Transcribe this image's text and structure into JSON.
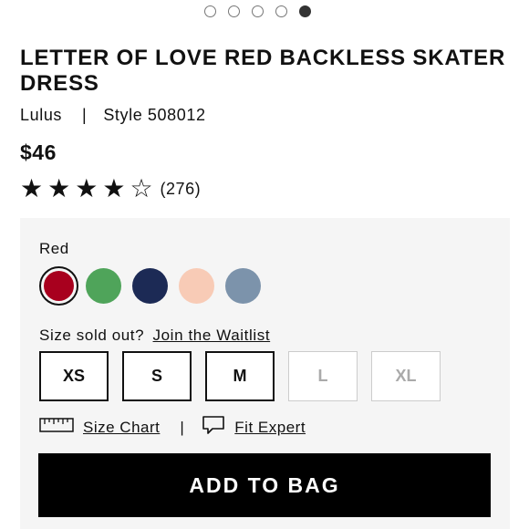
{
  "carousel": {
    "total": 5,
    "active_index": 4
  },
  "product": {
    "title": "LETTER OF LOVE RED BACKLESS SKATER DRESS",
    "brand": "Lulus",
    "separator": "|",
    "style": "Style 508012",
    "price": "$46",
    "rating": 4,
    "rating_max": 5,
    "review_count": "(276)"
  },
  "options": {
    "color_label": "Red",
    "colors": [
      {
        "name": "red",
        "hex": "#a8001e",
        "selected": true
      },
      {
        "name": "green",
        "hex": "#4fa45a",
        "selected": false
      },
      {
        "name": "navy",
        "hex": "#1c2a55",
        "selected": false
      },
      {
        "name": "blush",
        "hex": "#f8cbb6",
        "selected": false
      },
      {
        "name": "slate-blue",
        "hex": "#7c93ab",
        "selected": false
      }
    ],
    "waitlist_prompt": "Size sold out?",
    "waitlist_link": "Join the Waitlist",
    "sizes": [
      {
        "label": "XS",
        "available": true
      },
      {
        "label": "S",
        "available": true
      },
      {
        "label": "M",
        "available": true
      },
      {
        "label": "L",
        "available": false
      },
      {
        "label": "XL",
        "available": false
      }
    ],
    "size_chart_icon": "ruler-icon",
    "size_chart_label": "Size Chart",
    "tools_separator": "|",
    "fit_expert_icon": "chat-bubble-icon",
    "fit_expert_label": "Fit Expert",
    "add_to_bag_label": "ADD TO BAG"
  }
}
